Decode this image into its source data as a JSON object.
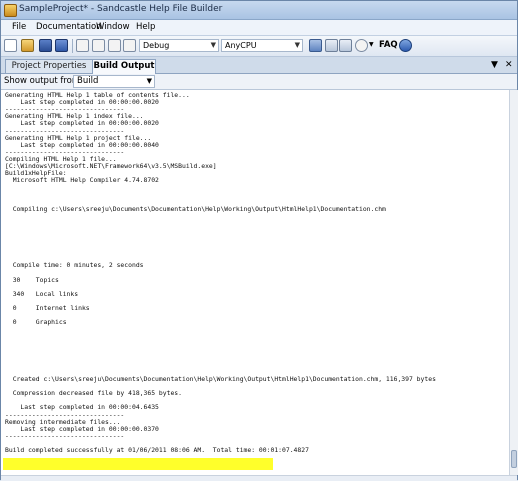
{
  "window": {
    "title": "SampleProject* - Sandcastle Help File Builder"
  },
  "menu": [
    "File",
    "Documentation",
    "Window",
    "Help"
  ],
  "toolbar": {
    "configuration": "Debug",
    "platform": "AnyCPU",
    "faq_label": "FAQ"
  },
  "tabs": [
    {
      "label": "Project Properties",
      "active": false
    },
    {
      "label": "Build Output",
      "active": true
    }
  ],
  "tab_controls": {
    "dropdown": "▼",
    "close": "✕"
  },
  "output_bar": {
    "label": "Show output from",
    "selected": "Build"
  },
  "output_lines": [
    "Generating HTML Help 1 table of contents file...",
    "    Last step completed in 00:00:00.0020",
    "-------------------------------",
    "Generating HTML Help 1 index file...",
    "    Last step completed in 00:00:00.0020",
    "-------------------------------",
    "Generating HTML Help 1 project file...",
    "    Last step completed in 00:00:00.0040",
    "-------------------------------",
    "Compiling HTML Help 1 file...",
    "[C:\\Windows\\Microsoft.NET\\Framework64\\v3.5\\MSBuild.exe]",
    "Build1xHelpFile:",
    "  Microsoft HTML Help Compiler 4.74.8702",
    "",
    "",
    "",
    "  Compiling c:\\Users\\sreeju\\Documents\\Documentation\\Help\\Working\\Output\\HtmlHelp1\\Documentation.chm",
    "",
    "",
    "",
    "",
    "",
    "",
    "",
    "  Compile time: 0 minutes, 2 seconds",
    "",
    "  30    Topics",
    "",
    "  340   Local links",
    "",
    "  0     Internet links",
    "",
    "  0     Graphics",
    "",
    "",
    "",
    "",
    "",
    "",
    "",
    "  Created c:\\Users\\sreeju\\Documents\\Documentation\\Help\\Working\\Output\\HtmlHelp1\\Documentation.chm, 116,397 bytes",
    "",
    "  Compression decreased file by 418,365 bytes.",
    "",
    "    Last step completed in 00:00:04.6435",
    "-------------------------------",
    "Removing intermediate files...",
    "    Last step completed in 00:00:00.0370",
    "-------------------------------",
    "",
    "Build completed successfully at 01/06/2011 08:06 AM.  Total time: 00:01:07.4827"
  ]
}
